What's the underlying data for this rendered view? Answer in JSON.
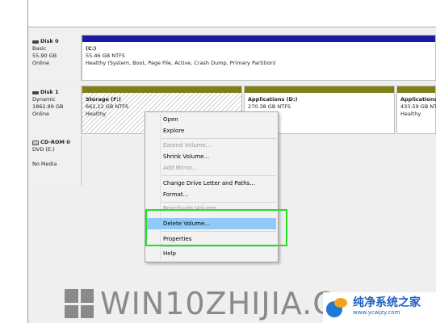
{
  "disks": [
    {
      "name": "Disk 0",
      "type": "Basic",
      "size": "55.90 GB",
      "status": "Online",
      "volumes": [
        {
          "name": "(C:)",
          "size": "55.46 GB NTFS",
          "health": "Healthy (System, Boot, Page File, Active, Crash Dump, Primary Partition)",
          "bar_color": "#1a1aa0"
        }
      ]
    },
    {
      "name": "Disk 1",
      "type": "Dynamic",
      "size": "1862.89 GB",
      "status": "Online",
      "volumes": [
        {
          "name": "Storage  (F:)",
          "size": "661.12 GB NTFS",
          "health": "Healthy",
          "bar_color": "#7f7f18"
        },
        {
          "name": "Applications  (D:)",
          "size": "270.38 GB NTFS",
          "health": "",
          "bar_color": "#7f7f18"
        },
        {
          "name": "Applications",
          "size": "433.59 GB NT",
          "health": "Healthy",
          "bar_color": "#7f7f18"
        }
      ]
    },
    {
      "name": "CD-ROM 0",
      "type": "DVD (E:)",
      "size": "",
      "status": "No Media"
    }
  ],
  "context_menu": {
    "items": [
      {
        "label": "Open",
        "enabled": true
      },
      {
        "label": "Explore",
        "enabled": true
      },
      {
        "label": "Extend Volume...",
        "enabled": false
      },
      {
        "label": "Shrink Volume...",
        "enabled": true
      },
      {
        "label": "Add Mirror...",
        "enabled": false
      },
      {
        "label": "Change Drive Letter and Paths...",
        "enabled": true
      },
      {
        "label": "Format...",
        "enabled": true
      },
      {
        "label": "Reactivate Volume",
        "enabled": false
      },
      {
        "label": "Delete Volume...",
        "enabled": true,
        "highlighted": true
      },
      {
        "label": "Properties",
        "enabled": true
      },
      {
        "label": "Help",
        "enabled": true
      }
    ]
  },
  "watermark": {
    "text": "WIN10ZHIJIA.C",
    "site_name": "纯净系统之家",
    "site_url": "www.ycwjzy.com"
  },
  "colors": {
    "highlight": "#91c9f7",
    "annotation_box": "#22e022",
    "primary_partition_bar": "#1a1aa0",
    "dynamic_volume_bar": "#7f7f18"
  }
}
